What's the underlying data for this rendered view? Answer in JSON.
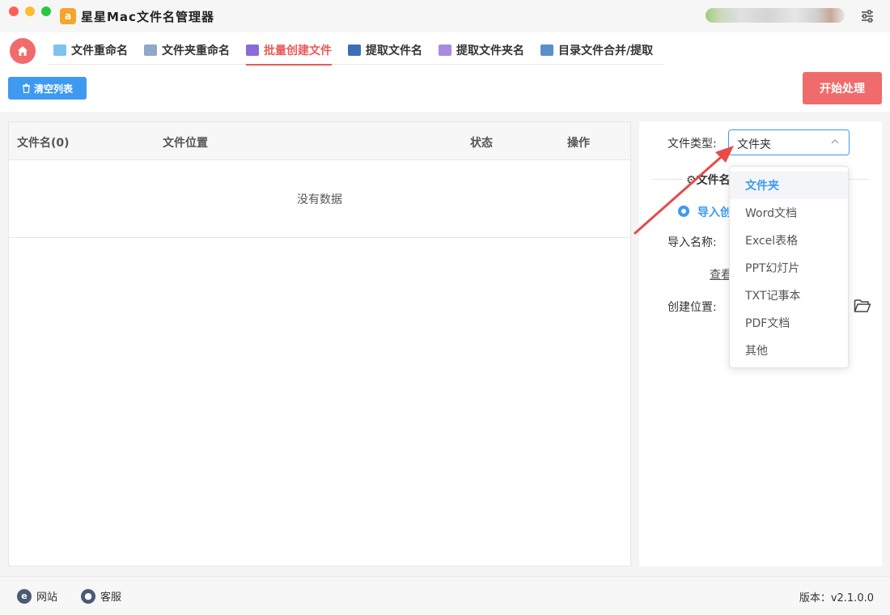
{
  "app": {
    "title": "星星Mac文件名管理器",
    "logo_char": "a"
  },
  "tabs": [
    {
      "label": "文件重命名",
      "icon": "file-rename-icon",
      "color": "#5aa9e6"
    },
    {
      "label": "文件夹重命名",
      "icon": "folder-rename-icon",
      "color": "#6d8fb8"
    },
    {
      "label": "批量创建文件",
      "icon": "batch-create-icon",
      "color": "#8a6ad8",
      "active": true
    },
    {
      "label": "提取文件名",
      "icon": "extract-filename-icon",
      "color": "#3d6fb8"
    },
    {
      "label": "提取文件夹名",
      "icon": "extract-foldername-icon",
      "color": "#9b7ad8"
    },
    {
      "label": "目录文件合并/提取",
      "icon": "merge-extract-icon",
      "color": "#5b8fc8"
    }
  ],
  "toolbar": {
    "clear_label": "清空列表",
    "start_label": "开始处理"
  },
  "table": {
    "columns": [
      "文件名(0)",
      "文件位置",
      "状态",
      "操作"
    ],
    "empty_text": "没有数据"
  },
  "panel": {
    "file_type_label": "文件类型:",
    "file_type_value": "文件夹",
    "section_title": "文件名",
    "radio_label": "导入创",
    "import_name_label": "导入名称:",
    "view_link": "查看",
    "location_label": "创建位置:"
  },
  "dropdown": {
    "options": [
      "文件夹",
      "Word文档",
      "Excel表格",
      "PPT幻灯片",
      "TXT记事本",
      "PDF文档",
      "其他"
    ],
    "selected": "文件夹"
  },
  "footer": {
    "website_label": "网站",
    "service_label": "客服",
    "version_text": "版本：v2.1.0.0"
  },
  "colors": {
    "accent": "#3d9af0",
    "danger": "#f06b6b",
    "active_tab": "#e85b5b",
    "arrow": "#e84a4a"
  }
}
